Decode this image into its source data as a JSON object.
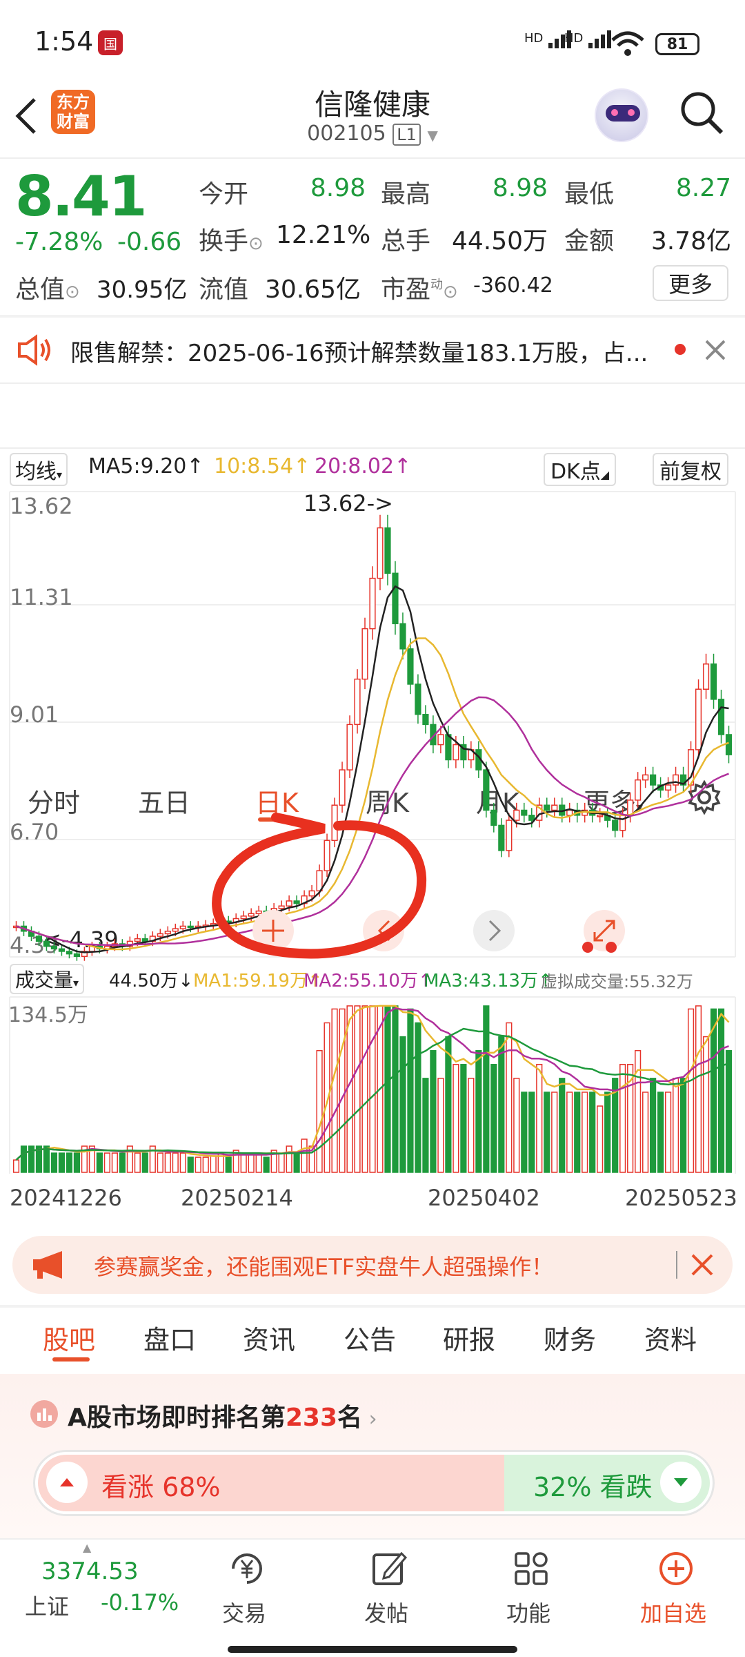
{
  "status_bar": {
    "time": "1:54",
    "app_badge": "国",
    "network1": "HD",
    "network2": "HD",
    "battery": "81"
  },
  "header": {
    "logo_text": "东方财富",
    "stock_name": "信隆健康",
    "stock_code": "002105",
    "level": "L1"
  },
  "quote": {
    "price": "8.41",
    "change_pct": "-7.28%",
    "change": "-0.66",
    "open_label": "今开",
    "open": "8.98",
    "high_label": "最高",
    "high": "8.98",
    "low_label": "最低",
    "low": "8.27",
    "turnover_label": "换手",
    "turnover": "12.21%",
    "volume_label": "总手",
    "volume": "44.50万",
    "amount_label": "金额",
    "amount": "3.78亿",
    "total_cap_label": "总值",
    "total_cap": "30.95亿",
    "float_cap_label": "流值",
    "float_cap": "30.65亿",
    "pe_label": "市盈",
    "pe_sup": "动",
    "pe": "-360.42",
    "more_label": "更多"
  },
  "notice": {
    "text": "限售解禁：2025-06-16预计解禁数量183.1万股，占..."
  },
  "period_tabs": {
    "items": [
      "分时",
      "五日",
      "日K",
      "周K",
      "月K",
      "更多"
    ],
    "active": "日K"
  },
  "kline_header": {
    "indicator": "均线",
    "ma5": "MA5:9.20",
    "ma10": "10:8.54",
    "ma20": "20:8.02",
    "dk": "DK点",
    "adjust": "前复权"
  },
  "kline_axis": {
    "y_top": "13.62",
    "y2": "11.31",
    "y3": "9.01",
    "y4": "6.70",
    "y_bottom": "4.39",
    "max_label": "13.62->",
    "min_label": "<-4.39"
  },
  "volume_header": {
    "indicator": "成交量",
    "vol": "44.50万",
    "ma1": "MA1:59.19万",
    "ma2": "MA2:55.10万",
    "ma3": "MA3:43.13万",
    "virtual": "虚拟成交量:55.32万",
    "top": "134.5万"
  },
  "x_dates": [
    "20241226",
    "20250214",
    "20250402",
    "20250523"
  ],
  "ad_banner": {
    "text": "参赛赢奖金，还能围观ETF实盘牛人超强操作！"
  },
  "bottom_tabs": {
    "items": [
      "股吧",
      "盘口",
      "资讯",
      "公告",
      "研报",
      "财务",
      "资料"
    ],
    "active": "股吧"
  },
  "rank": {
    "prefix": "A股市场即时排名第",
    "number": "233",
    "suffix": "名"
  },
  "sentiment": {
    "bull_label": "看涨 68%",
    "bear_label": "32% 看跌",
    "bull_pct": 68
  },
  "footer": {
    "index_value": "3374.53",
    "index_name": "上证",
    "index_change": "-0.17%",
    "items": [
      "交易",
      "发帖",
      "功能",
      "加自选"
    ]
  },
  "colors": {
    "up": "#e6332a",
    "down": "#1e9a3c",
    "accent": "#e8502a",
    "ma5": "#222222",
    "ma10": "#e8b830",
    "ma20": "#b0309c"
  },
  "chart_data": {
    "type": "candlestick",
    "ylim": [
      4.39,
      13.62
    ],
    "x_ticks": [
      "20241226",
      "20250214",
      "20250402",
      "20250523"
    ],
    "close": [
      5.0,
      4.9,
      4.8,
      4.7,
      4.6,
      4.55,
      4.5,
      4.45,
      4.4,
      4.5,
      4.6,
      4.55,
      4.6,
      4.65,
      4.6,
      4.7,
      4.75,
      4.7,
      4.8,
      4.85,
      4.9,
      4.95,
      5.0,
      4.98,
      5.0,
      5.02,
      5.05,
      5.1,
      5.08,
      5.15,
      5.2,
      5.25,
      5.3,
      5.28,
      5.35,
      5.4,
      5.5,
      5.45,
      5.6,
      5.7,
      6.1,
      6.7,
      7.4,
      8.1,
      9.0,
      9.9,
      10.9,
      11.9,
      12.9,
      12.0,
      11.0,
      10.5,
      9.8,
      9.2,
      9.0,
      8.6,
      8.8,
      8.3,
      8.6,
      8.3,
      8.5,
      8.1,
      7.3,
      7.0,
      6.5,
      7.1,
      7.3,
      7.2,
      7.1,
      7.4,
      7.3,
      7.4,
      7.2,
      7.3,
      7.2,
      7.3,
      7.2,
      7.2,
      7.1,
      6.9,
      7.2,
      7.5,
      7.9,
      8.0,
      7.8,
      7.7,
      7.8,
      8.0,
      7.8,
      8.5,
      9.7,
      10.2,
      9.5,
      8.8,
      8.4
    ]
  }
}
